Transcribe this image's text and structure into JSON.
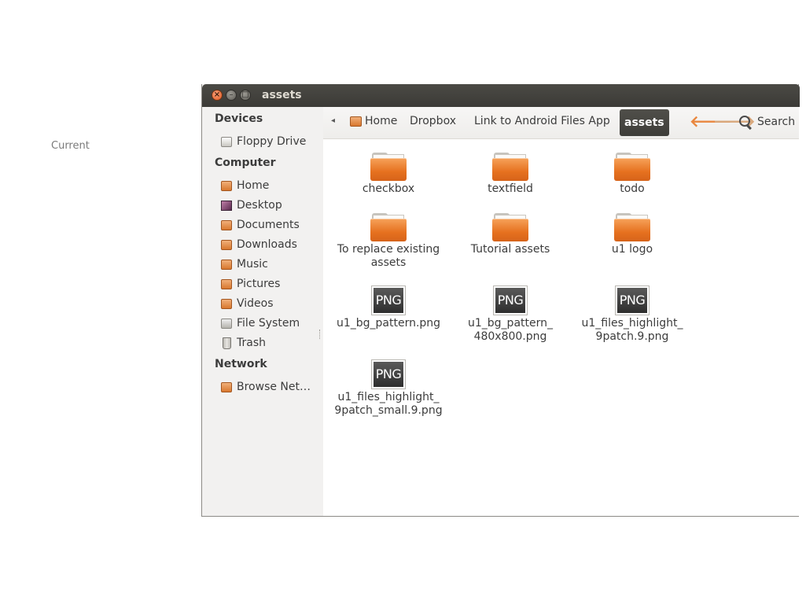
{
  "outer_label": "Current",
  "window": {
    "title": "assets",
    "buttons": {
      "close": "×",
      "minimize": "–",
      "maximize": "□"
    }
  },
  "sidebar": {
    "sections": [
      {
        "heading": "Devices",
        "items": [
          {
            "label": "Floppy Drive",
            "icon": "floppy-drive-icon"
          }
        ]
      },
      {
        "heading": "Computer",
        "items": [
          {
            "label": "Home",
            "icon": "home-folder-icon"
          },
          {
            "label": "Desktop",
            "icon": "desktop-icon"
          },
          {
            "label": "Documents",
            "icon": "documents-folder-icon"
          },
          {
            "label": "Downloads",
            "icon": "downloads-folder-icon"
          },
          {
            "label": "Music",
            "icon": "music-folder-icon"
          },
          {
            "label": "Pictures",
            "icon": "pictures-folder-icon"
          },
          {
            "label": "Videos",
            "icon": "videos-folder-icon"
          },
          {
            "label": "File System",
            "icon": "file-system-icon"
          },
          {
            "label": "Trash",
            "icon": "trash-icon"
          }
        ]
      },
      {
        "heading": "Network",
        "items": [
          {
            "label": "Browse Net…",
            "icon": "network-folder-icon"
          }
        ]
      }
    ]
  },
  "toolbar": {
    "back_crumb_arrow": "◂",
    "breadcrumbs": [
      "Home",
      "Dropbox",
      "Link to Android Files App",
      "assets"
    ],
    "active_crumb": "assets",
    "back_arrow": "🡐",
    "forward_arrow": "🡒",
    "search_label": "Search"
  },
  "files": [
    {
      "name": "checkbox",
      "type": "folder"
    },
    {
      "name": "textfield",
      "type": "folder"
    },
    {
      "name": "todo",
      "type": "folder"
    },
    {
      "name": "To replace existing assets",
      "type": "folder"
    },
    {
      "name": "Tutorial assets",
      "type": "folder"
    },
    {
      "name": "u1 logo",
      "type": "folder"
    },
    {
      "name": "u1_bg_pattern.png",
      "type": "png",
      "badge": "PNG"
    },
    {
      "name": "u1_bg_pattern_ 480x800.png",
      "type": "png",
      "badge": "PNG"
    },
    {
      "name": "u1_files_highlight_ 9patch.9.png",
      "type": "png",
      "badge": "PNG"
    },
    {
      "name": "u1_files_highlight_ 9patch_small.9.png",
      "type": "png",
      "badge": "PNG"
    }
  ],
  "colors": {
    "accent_orange": "#e6711f",
    "titlebar": "#3b3a36",
    "sidebar_bg": "#f2f1f0"
  }
}
